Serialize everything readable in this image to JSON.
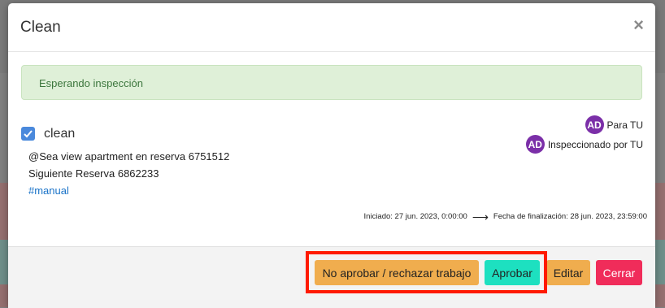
{
  "modal": {
    "title": "Clean",
    "close_glyph": "×",
    "status_alert": "Esperando inspección",
    "task": {
      "checked": true,
      "name": "clean",
      "lines": [
        "@Sea view apartment en reserva 6751512",
        "Siguiente Reserva 6862233"
      ],
      "tag": "#manual"
    },
    "assignees": [
      {
        "initials": "AD",
        "label": "Para TU"
      },
      {
        "initials": "AD",
        "label": "Inspeccionado por TU"
      }
    ],
    "avatar_color": "#7b2fa8",
    "times": {
      "started": "Iniciado: 27 jun. 2023, 0:00:00",
      "arrow": "⟶",
      "finished": "Fecha de finalización: 28 jun. 2023, 23:59:00"
    },
    "footer": {
      "reject_label": "No aprobar / rechazar trabajo",
      "approve_label": "Aprobar",
      "edit_label": "Editar",
      "close_label": "Cerrar"
    }
  },
  "colors": {
    "reject": "#f0ad4e",
    "approve": "#1de0c0",
    "edit": "#f0ad4e",
    "close": "#f02c5a",
    "highlight": "#ff1a00"
  }
}
